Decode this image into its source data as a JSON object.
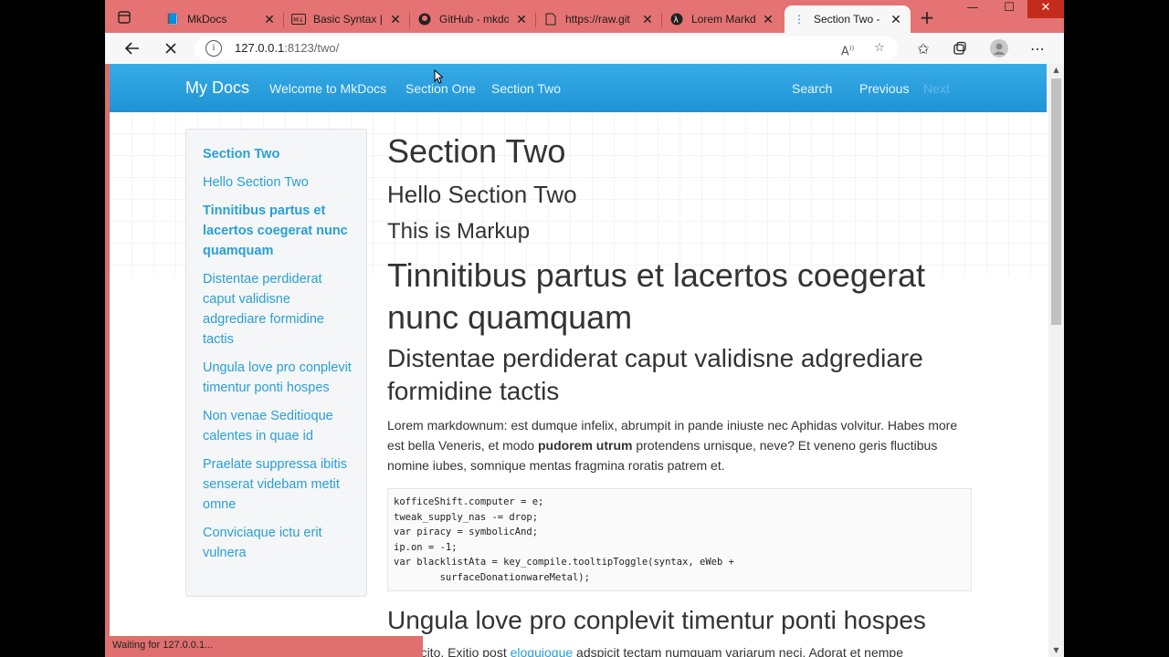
{
  "browser": {
    "tabs": [
      {
        "title": "MkDocs",
        "icon": "book-icon"
      },
      {
        "title": "Basic Syntax | M",
        "icon": "markdown-icon"
      },
      {
        "title": "GitHub - mkdo",
        "icon": "github-icon"
      },
      {
        "title": "https://raw.git",
        "icon": "document-icon"
      },
      {
        "title": "Lorem Markdo",
        "icon": "lambda-icon"
      },
      {
        "title": "Section Two -",
        "icon": "loading-dots-icon"
      }
    ],
    "url_host": "127.0.0.1",
    "url_rest": ":8123/two/",
    "status_text": "Waiting for 127.0.0.1..."
  },
  "navbar": {
    "brand": "My Docs",
    "links": [
      "Welcome to MkDocs",
      "Section One",
      "Section Two"
    ],
    "search": "Search",
    "previous": "Previous",
    "next": "Next"
  },
  "sidebar": {
    "items": [
      {
        "label": "Section Two",
        "bold": true
      },
      {
        "label": "Hello Section Two",
        "bold": false
      },
      {
        "label": "Tinnitibus partus et lacertos coegerat nunc quamquam",
        "bold": true
      },
      {
        "label": "Distentae perdiderat caput validisne adgrediare formidine tactis",
        "bold": false
      },
      {
        "label": "Ungula love pro conplevit timentur ponti hospes",
        "bold": false
      },
      {
        "label": "Non venae Seditioque calentes in quae id",
        "bold": false
      },
      {
        "label": "Praelate suppressa ibitis senserat videbam metit omne",
        "bold": false
      },
      {
        "label": "Conviciaque ictu erit vulnera",
        "bold": false
      }
    ]
  },
  "content": {
    "title": "Section Two",
    "subtitle": "Hello Section Two",
    "markup": "This is Markup",
    "h1": "Tinnitibus partus et lacertos coegerat nunc quamquam",
    "h2": "Distentae perdiderat caput validisne adgrediare formidine tactis",
    "para_before": "Lorem markdownum: est dumque infelix, abrumpit in pande iniuste nec Aphidas volvitur. Habes more est bella Veneris, et modo ",
    "para_bold": "pudorem utrum",
    "para_after": " protendens urnisque, neve? Et veneno geris fluctibus nomine iubes, somnique mentas fragmina roratis patrem et.",
    "code": "kofficeShift.computer = e;\ntweak_supply_nas -= drop;\nvar piracy = symbolicAnd;\nip.on = -1;\nvar blacklistAta = key_compile.tooltipToggle(syntax, eWeb +\n        surfaceDonationwareMetal);",
    "h2b": "Ungula love pro conplevit timentur ponti hospes",
    "last_before": "Nunc cito. Exitio post ",
    "last_link": "eloquioque",
    "last_after": " adspicit tectam numquam variarum neci. Adorat et nempe"
  }
}
